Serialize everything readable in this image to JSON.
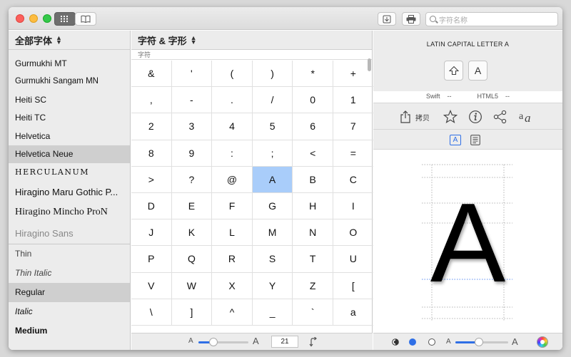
{
  "titlebar": {
    "search_placeholder": "字符名称",
    "view_grid_icon": "grid-view-icon",
    "view_book_icon": "book-view-icon"
  },
  "font_list": {
    "header": "全部字体",
    "fonts": [
      {
        "name": "Gurmukhi MT",
        "selected": false
      },
      {
        "name": "Gurmukhi Sangam MN",
        "selected": false
      },
      {
        "name": "Heiti SC",
        "selected": false
      },
      {
        "name": "Heiti TC",
        "selected": false
      },
      {
        "name": "Helvetica",
        "selected": false
      },
      {
        "name": "Helvetica Neue",
        "selected": true
      },
      {
        "name": "HERCULANUM",
        "selected": false
      },
      {
        "name": "Hiragino Maru Gothic P...",
        "selected": false
      },
      {
        "name": "Hiragino Mincho ProN",
        "selected": false
      },
      {
        "name": "Hiragino Sans",
        "selected": false
      }
    ],
    "styles": [
      {
        "name": "Thin",
        "selected": false
      },
      {
        "name": "Thin Italic",
        "selected": false
      },
      {
        "name": "Regular",
        "selected": true
      },
      {
        "name": "Italic",
        "selected": false
      },
      {
        "name": "Medium",
        "selected": false
      }
    ]
  },
  "glyph_panel": {
    "header": "字符 & 字形",
    "sub_header": "字符",
    "glyphs": [
      [
        "&",
        "'",
        "(",
        ")",
        "*",
        "+"
      ],
      [
        ",",
        "-",
        ".",
        "/",
        "0",
        "1"
      ],
      [
        "2",
        "3",
        "4",
        "5",
        "6",
        "7"
      ],
      [
        "8",
        "9",
        ":",
        ";",
        "<",
        "="
      ],
      [
        ">",
        "?",
        "@",
        "A",
        "B",
        "C"
      ],
      [
        "D",
        "E",
        "F",
        "G",
        "H",
        "I"
      ],
      [
        "J",
        "K",
        "L",
        "M",
        "N",
        "O"
      ],
      [
        "P",
        "Q",
        "R",
        "S",
        "T",
        "U"
      ],
      [
        "V",
        "W",
        "X",
        "Y",
        "Z",
        "["
      ],
      [
        "\\",
        "]",
        "^",
        "_",
        "`",
        "a"
      ]
    ],
    "selected_glyph": "A",
    "size_small_label": "A",
    "size_large_label": "A",
    "size_slider_fraction": 0.3,
    "font_size_value": "21"
  },
  "detail_panel": {
    "char_name": "LATIN CAPITAL LETTER A",
    "shift_key_icon": "shift-key-icon",
    "key_label": "A",
    "swift_label": "Swift",
    "swift_value": "--",
    "html5_label": "HTML5",
    "html5_value": "--",
    "copy_label": "拷贝",
    "preview_glyph": "A",
    "footer_size_small": "A",
    "footer_size_large": "A",
    "footer_slider_fraction": 0.45,
    "accent_color": "#2f6fe6",
    "selection_color": "#a9cdfa"
  }
}
